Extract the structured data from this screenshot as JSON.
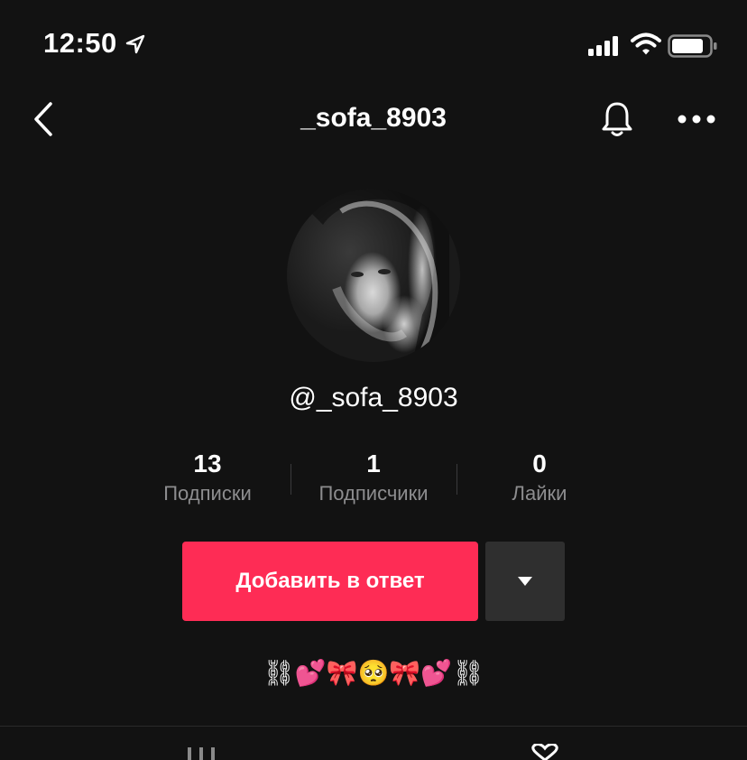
{
  "status_bar": {
    "time": "12:50",
    "icons": [
      "location-arrow-icon",
      "cellular-signal-icon",
      "wifi-icon",
      "battery-icon"
    ]
  },
  "nav": {
    "title": "_sofa_8903",
    "icons": [
      "back-chevron-icon",
      "bell-icon",
      "more-dots-icon"
    ]
  },
  "profile": {
    "handle": "@_sofa_8903",
    "stats": [
      {
        "value": "13",
        "label": "Подписки"
      },
      {
        "value": "1",
        "label": "Подписчики"
      },
      {
        "value": "0",
        "label": "Лайки"
      }
    ],
    "follow_button": "Добавить в ответ",
    "bio": "⛓💕🎀🥺🎀💕⛓"
  },
  "tabs": {
    "icons": [
      "videos-grid-icon",
      "liked-heart-icon"
    ]
  },
  "colors": {
    "background": "#121212",
    "accent": "#fe2c55",
    "secondary_button": "#2f2f2f",
    "muted_text": "#8d8d8f"
  }
}
